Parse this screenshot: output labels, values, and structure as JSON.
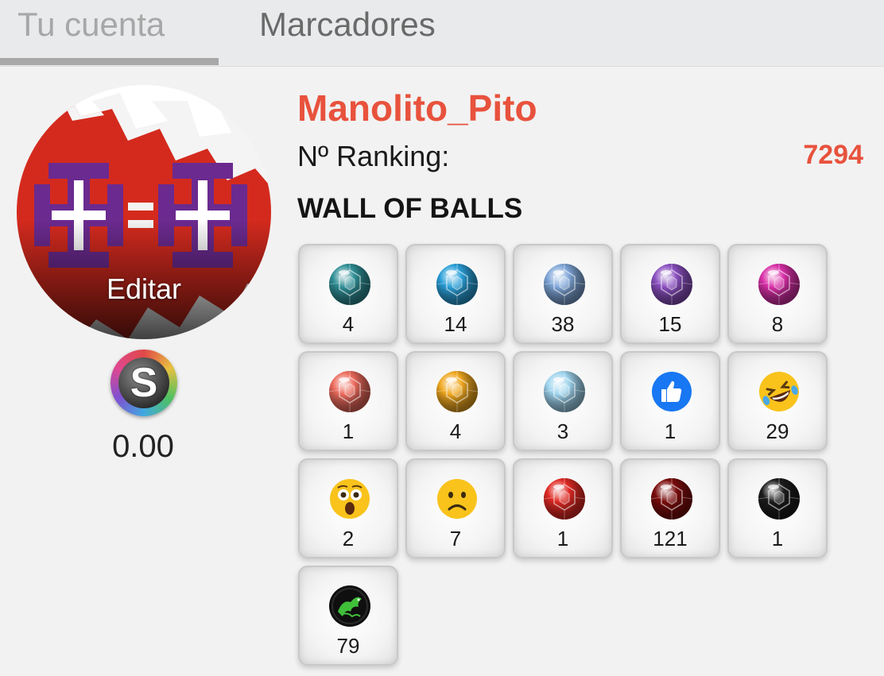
{
  "tabs": {
    "account_label": "Tu cuenta",
    "bookmarks_label": "Marcadores"
  },
  "profile": {
    "avatar_edit_label": "Editar",
    "balance": "0.00",
    "username": "Manolito_Pito",
    "ranking_label": "Nº Ranking:",
    "ranking_value": "7294"
  },
  "wall": {
    "title": "WALL OF BALLS",
    "balls": [
      {
        "name": "teal-gem-ball-icon",
        "kind": "gem",
        "color": "#2f8f96",
        "count": "4"
      },
      {
        "name": "blue-gem-ball-icon",
        "kind": "gem",
        "color": "#2a9fd8",
        "count": "14"
      },
      {
        "name": "light-blue-gem-ball-icon",
        "kind": "gem",
        "color": "#7fa6d8",
        "count": "38"
      },
      {
        "name": "purple-gem-ball-icon",
        "kind": "gem",
        "color": "#8a4fc0",
        "count": "15"
      },
      {
        "name": "magenta-gem-ball-icon",
        "kind": "gem",
        "color": "#d92fa8",
        "count": "8"
      },
      {
        "name": "salmon-gem-ball-icon",
        "kind": "gem",
        "color": "#ec6a5c",
        "count": "1"
      },
      {
        "name": "gold-gem-ball-icon",
        "kind": "gem",
        "color": "#f0a820",
        "count": "4"
      },
      {
        "name": "diamond-ball-icon",
        "kind": "gem",
        "color": "#9fd4ee",
        "count": "3"
      },
      {
        "name": "thumbs-up-icon",
        "kind": "like",
        "color": "#1877f2",
        "count": "1"
      },
      {
        "name": "laughing-emoji-icon",
        "kind": "laugh",
        "color": "#f9c31c",
        "count": "29"
      },
      {
        "name": "shocked-emoji-icon",
        "kind": "wow",
        "color": "#f9c31c",
        "count": "2"
      },
      {
        "name": "sad-emoji-icon",
        "kind": "sad",
        "color": "#f9c31c",
        "count": "7"
      },
      {
        "name": "red-gem-ball-icon",
        "kind": "gem",
        "color": "#e02a24",
        "count": "1"
      },
      {
        "name": "dark-red-gem-ball-icon",
        "kind": "gem",
        "color": "#7a0c0c",
        "count": "121"
      },
      {
        "name": "black-gem-ball-icon",
        "kind": "gem",
        "color": "#1c1c1c",
        "count": "1"
      },
      {
        "name": "green-dragon-ball-icon",
        "kind": "dragon",
        "color": "#3fbf3a",
        "count": "79"
      }
    ]
  },
  "colors": {
    "accent": "#e8523d",
    "background": "#f2f2f2",
    "tabbar": "#e9eaeb"
  }
}
